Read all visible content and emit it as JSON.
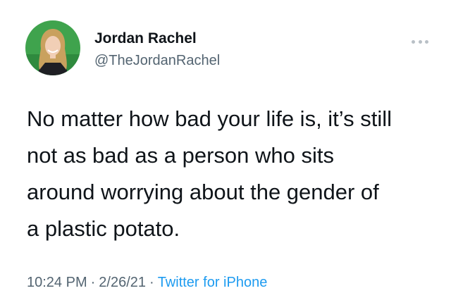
{
  "author": {
    "name": "Jordan Rachel",
    "handle": "@TheJordanRachel",
    "avatar_icon": "profile-photo"
  },
  "tweet": {
    "lines": [
      "No matter how bad your life is, it’s still",
      "not as bad as a person who sits",
      "around worrying about the gender of",
      "a plastic potato."
    ]
  },
  "meta": {
    "time": "10:24 PM",
    "separator": "·",
    "date": "2/26/21",
    "source": "Twitter for iPhone"
  },
  "menu_icon": "more-horizontal-icon",
  "colors": {
    "text": "#0f1419",
    "secondary": "#536471",
    "link": "#1d9bf0",
    "background": "#ffffff"
  }
}
